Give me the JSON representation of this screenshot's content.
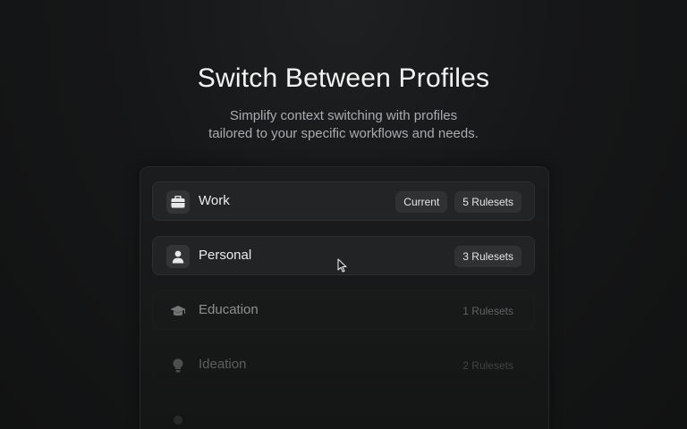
{
  "hero": {
    "title": "Switch Between Profiles",
    "subtitle_line1": "Simplify context switching with profiles",
    "subtitle_line2": "tailored to your specific workflows and needs."
  },
  "profiles": [
    {
      "icon": "briefcase-icon",
      "label": "Work",
      "current_label": "Current",
      "rulesets": "5 Rulesets"
    },
    {
      "icon": "person-icon",
      "label": "Personal",
      "rulesets": "3 Rulesets"
    },
    {
      "icon": "graduation-cap-icon",
      "label": "Education",
      "rulesets": "1 Rulesets"
    },
    {
      "icon": "lightbulb-icon",
      "label": "Ideation",
      "rulesets": "2 Rulesets"
    },
    {
      "icon": "profile-icon",
      "label": ""
    }
  ],
  "colors": {
    "background": "#161718",
    "row_active": "#232425",
    "chip": "#303132",
    "subtitle": "#a9acae"
  }
}
